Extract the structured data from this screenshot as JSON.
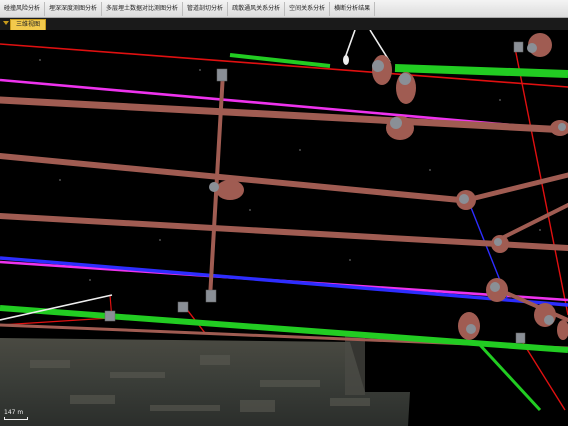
{
  "toolbar": {
    "items": [
      "碰撞风险分析",
      "埋深深度测图分析",
      "多层埋土数据对比测图分析",
      "管道剖切分析",
      "疏散通风关系分析",
      "空间关系分析",
      "横断分析结果"
    ]
  },
  "tabs": {
    "active_label": "三维视图"
  },
  "scene": {
    "scale_label": "147 m",
    "colors": {
      "pipe_brown": "#a05c52",
      "pipe_magenta": "#ee33ee",
      "pipe_blue": "#2d2dff",
      "pipe_green": "#22cc22",
      "pipe_red": "#e01010",
      "pipe_white": "#eeeeee",
      "joint_gray": "#8a8f96"
    }
  }
}
